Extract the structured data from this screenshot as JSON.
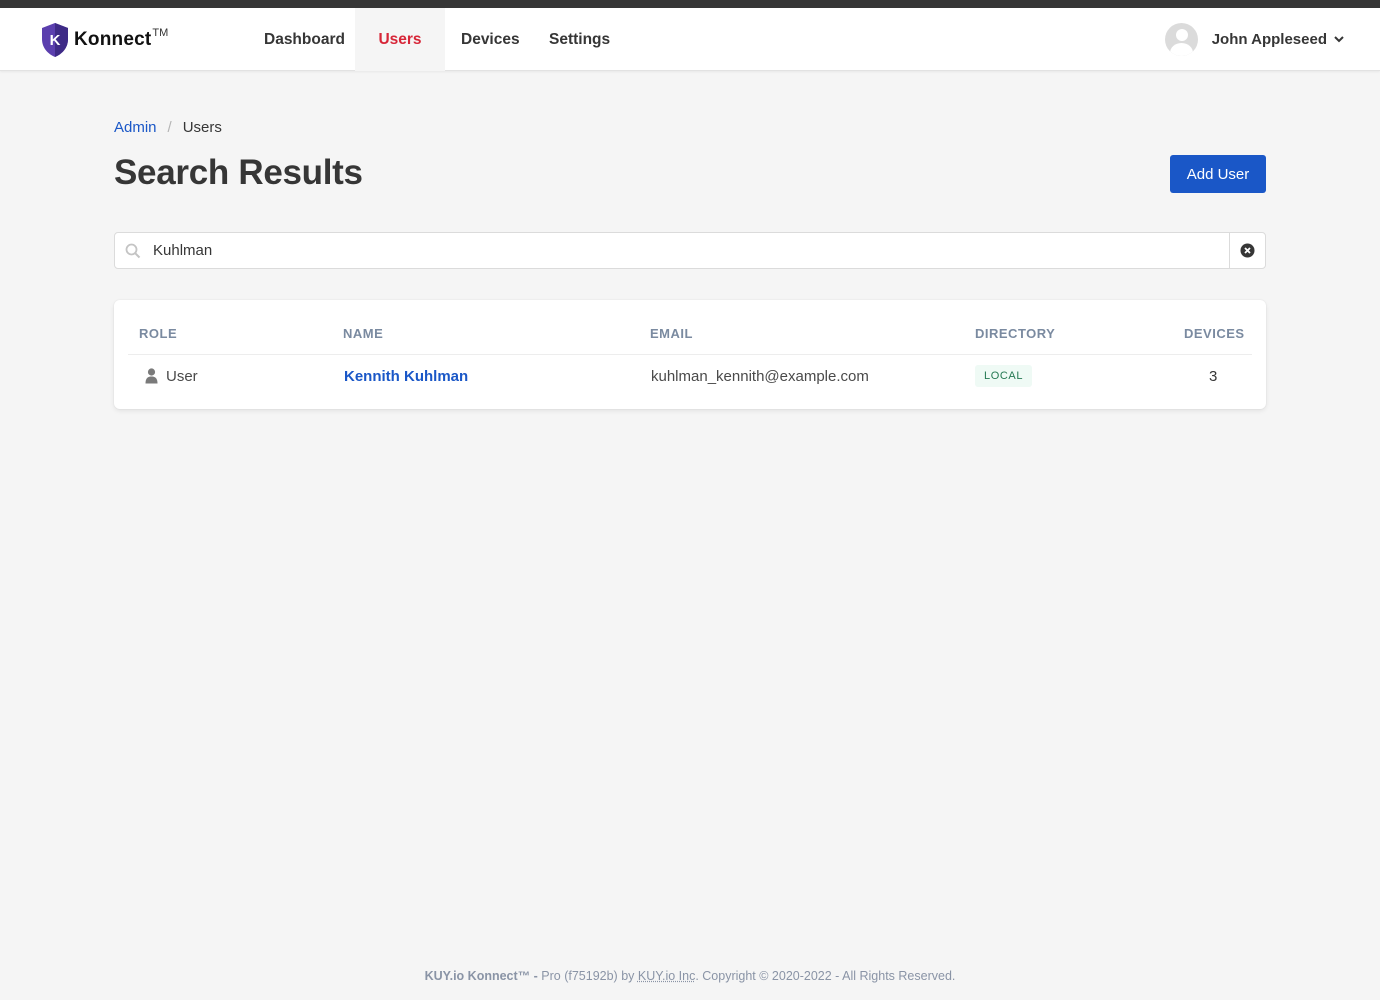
{
  "brand": {
    "name": "Konnect",
    "trademark": "TM",
    "shield_letter": "K",
    "colors": {
      "shield": "#5b3fae",
      "shield_dark": "#3e2a86"
    }
  },
  "nav": {
    "items": [
      {
        "label": "Dashboard",
        "active": false
      },
      {
        "label": "Users",
        "active": true
      },
      {
        "label": "Devices",
        "active": false
      },
      {
        "label": "Settings",
        "active": false
      }
    ],
    "user": {
      "name": "John Appleseed",
      "icon": "chevron-down-icon"
    }
  },
  "breadcrumb": {
    "root": "Admin",
    "separator": "/",
    "current": "Users"
  },
  "page": {
    "title": "Search Results",
    "add_button": "Add User"
  },
  "search": {
    "value": "Kuhlman",
    "clear_icon": "times-circle-icon"
  },
  "table": {
    "headers": {
      "role": "ROLE",
      "name": "NAME",
      "email": "EMAIL",
      "directory": "DIRECTORY",
      "devices": "DEVICES"
    },
    "rows": [
      {
        "role": "User",
        "role_icon": "user-icon",
        "name": "Kennith Kuhlman",
        "email": "kuhlman_kennith@example.com",
        "directory": "LOCAL",
        "devices": "3"
      }
    ]
  },
  "footer": {
    "product": "KUY.io Konnect™ -",
    "edition": " Pro (f75192b) by ",
    "company": "KUY.io Inc",
    "copyright": ". Copyright © 2020-2022 - All Rights Reserved."
  },
  "colors": {
    "accent": "#1a57c7",
    "active_nav": "#d72638",
    "tag_bg": "#effaf5",
    "tag_text": "#257953",
    "background": "#f5f5f5"
  }
}
